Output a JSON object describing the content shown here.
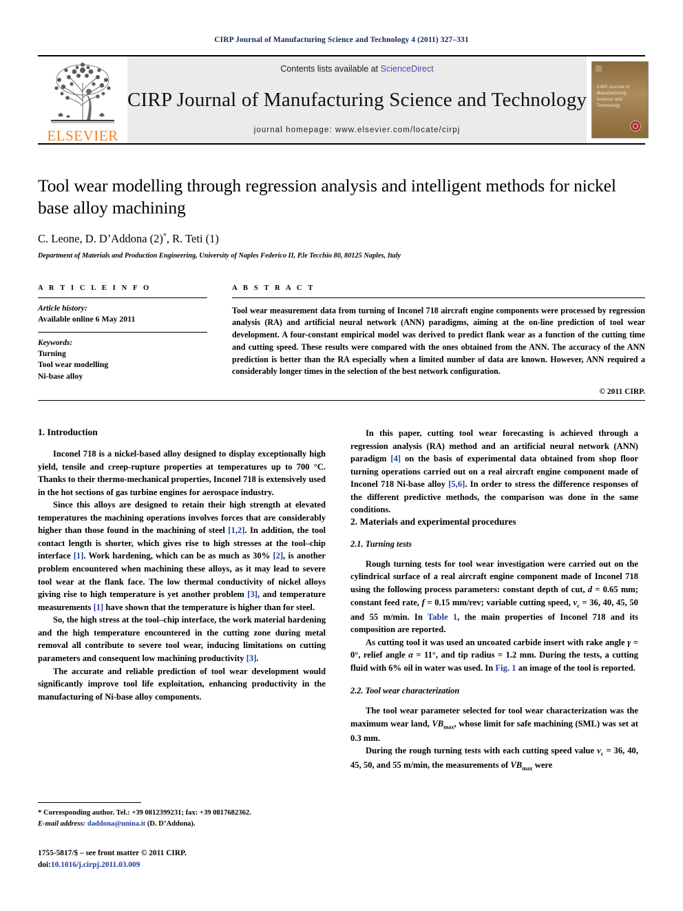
{
  "running_head": "CIRP Journal of Manufacturing Science and Technology 4 (2011) 327–331",
  "masthead": {
    "publisher_name": "ELSEVIER",
    "contents_prefix": "Contents lists available at ",
    "contents_link": "ScienceDirect",
    "journal_name": "CIRP Journal of Manufacturing Science and Technology",
    "homepage": "journal homepage: www.elsevier.com/locate/cirpj",
    "cover_title": "CIRP Journal of Manufacturing Science and Technology"
  },
  "title": "Tool wear modelling through regression analysis and intelligent methods for nickel base alloy machining",
  "authors_pre": "C. Leone, D. D’Addona  (2)",
  "authors_post": ", R. Teti  (1)",
  "authors_star": "*",
  "affiliation": "Department of Materials and Production Engineering, University of Naples Federico II, P.le Tecchio 80, 80125 Naples, Italy",
  "article_info": {
    "label": "A R T I C L E  I N F O",
    "history_head": "Article history:",
    "history_line": "Available online 6 May 2011",
    "keywords_head": "Keywords:",
    "keywords": [
      "Turning",
      "Tool wear modelling",
      "Ni-base alloy"
    ]
  },
  "abstract": {
    "label": "A B S T R A C T",
    "text": "Tool wear measurement data from turning of Inconel 718 aircraft engine components were processed by regression analysis (RA) and artificial neural network (ANN) paradigms, aiming at the on-line prediction of tool wear development. A four-constant empirical model was derived to predict flank wear as a function of the cutting time and cutting speed. These results were compared with the ones obtained from the ANN. The accuracy of the ANN prediction is better than the RA especially when a limited number of data are known. However, ANN required a considerably longer times in the selection of the best network configuration.",
    "copyright": "© 2011 CIRP."
  },
  "sections": {
    "intro_heading": "1.  Introduction",
    "intro_p1": "Inconel 718 is a nickel-based alloy designed to display exceptionally high yield, tensile and creep-rupture properties at temperatures up to 700 °C. Thanks to their thermo-mechanical properties, Inconel 718 is extensively used in the hot sections of gas turbine engines for aerospace industry.",
    "intro_p2_a": "Since this alloys are designed to retain their high strength at elevated temperatures the machining operations involves forces that are considerably higher than those found in the machining of steel ",
    "intro_p2_r1": "[1,2]",
    "intro_p2_b": ". In addition, the tool contact length is shorter, which gives rise to high stresses at the tool–chip interface ",
    "intro_p2_r2": "[1]",
    "intro_p2_c": ". Work hardening, which can be as much as 30% ",
    "intro_p2_r3": "[2]",
    "intro_p2_d": ", is another problem encountered when machining these alloys, as it may lead to severe tool wear at the flank face. The low thermal conductivity of nickel alloys giving rise to high temperature is yet another problem ",
    "intro_p2_r4": "[3]",
    "intro_p2_e": ", and temperature measurements ",
    "intro_p2_r5": "[1]",
    "intro_p2_f": " have shown that the temperature is higher than for steel.",
    "intro_p3_a": "So, the high stress at the tool–chip interface, the work material hardening and the high temperature encountered in the cutting zone during metal removal all contribute to severe tool wear, inducing limitations on cutting parameters and consequent low machining productivity ",
    "intro_p3_r1": "[3]",
    "intro_p3_b": ".",
    "intro_p4": "The accurate and reliable prediction of tool wear development would significantly improve tool life exploitation, enhancing productivity in the manufacturing of Ni-base alloy components.",
    "right_p1_a": "In this paper, cutting tool wear forecasting is achieved through a regression analysis (RA) method and an artificial neural network (ANN) paradigm ",
    "right_p1_r1": "[4]",
    "right_p1_b": " on the basis of experimental data obtained from shop floor turning operations carried out on a real aircraft engine component made of Inconel 718 Ni-base alloy ",
    "right_p1_r2": "[5,6]",
    "right_p1_c": ". In order to stress the difference responses of the different predictive methods, the comparison was done in the same conditions.",
    "sec2_heading": "2.  Materials and experimental procedures",
    "sec21_heading": "2.1.  Turning tests",
    "sec21_p1_a": "Rough turning tests for tool wear investigation were carried out on the cylindrical surface of a real aircraft engine component made of Inconel 718 using the following process parameters: constant depth of cut, ",
    "sec21_d": "d",
    "sec21_p1_b": " = 0.65 mm; constant feed rate, ",
    "sec21_f": "f",
    "sec21_p1_c": " = 0.15 mm/rev; variable cutting speed, ",
    "sec21_vc": "v",
    "sec21_vc_sub": "c",
    "sec21_p1_d": " = 36, 40, 45, 50 and 55 m/min. In ",
    "sec21_tableref": "Table 1",
    "sec21_p1_e": ", the main properties of Inconel 718 and its composition are reported.",
    "sec21_p2_a": "As cutting tool it was used an uncoated carbide insert with rake angle ",
    "sec21_gamma": "γ",
    "sec21_p2_b": " = 0°, relief angle ",
    "sec21_alpha": "α",
    "sec21_p2_c": " = 11°, and tip radius = 1.2 mm. During the tests, a cutting fluid with 6% oil in water was used. In ",
    "sec21_figref": "Fig. 1",
    "sec21_p2_d": " an image of the tool is reported.",
    "sec22_heading": "2.2.  Tool wear characterization",
    "sec22_p1_a": "The tool wear parameter selected for tool wear characterization was the maximum wear land, ",
    "sec22_vb": "VB",
    "sec22_vb_sub": "max",
    "sec22_p1_b": ", whose limit for safe machining (SML) was set at 0.3 mm.",
    "sec22_p2_a": "During the rough turning tests with each cutting speed value ",
    "sec22_vc": "v",
    "sec22_vc_sub": "c",
    "sec22_p2_b": " = 36, 40, 45, 50, and 55 m/min, the measurements of ",
    "sec22_vb2": "VB",
    "sec22_vb2_sub": "max",
    "sec22_p2_c": " were"
  },
  "footnotes": {
    "star": "*",
    "corresponding": "Corresponding author. Tel.: +39 0812399231; fax: +39 0817682362.",
    "email_label": "E-mail address:",
    "email": "daddona@unina.it",
    "email_suffix": "(D. D’Addona).",
    "issn_line": "1755-5817/$ – see front matter © 2011 CIRP.",
    "doi_prefix": "doi:",
    "doi": "10.1016/j.cirpj.2011.03.009"
  }
}
